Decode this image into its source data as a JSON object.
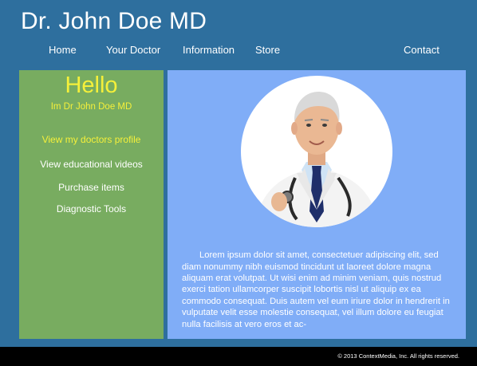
{
  "site": {
    "title": "Dr. John Doe MD"
  },
  "nav": {
    "items": [
      "Home",
      "Your Doctor",
      "Information",
      "Store",
      "Contact"
    ]
  },
  "sidebar": {
    "greeting": "Hello",
    "subtitle": "Im Dr John Doe MD",
    "links": [
      "View my doctors profile",
      "View educational videos",
      "Purchase items",
      "Diagnostic Tools"
    ]
  },
  "main": {
    "text": "Lorem ipsum dolor sit amet, consectetuer adipiscing elit, sed diam nonummy nibh euismod tincidunt ut laoreet dolore magna aliquam erat volutpat. Ut wisi enim ad minim veniam, quis nostrud exerci tation ullamcorper suscipit lobortis nisl ut aliquip ex ea commodo consequat. Duis autem vel eum iriure dolor in hendrerit in vulputate velit esse molestie consequat, vel illum dolore eu feugiat nulla facilisis at vero eros et ac-"
  },
  "footer": {
    "copyright": "© 2013 ContextMedia, Inc. All rights reserved."
  },
  "colors": {
    "page_bg": "#2e6f9e",
    "sidebar_bg": "#78ac60",
    "main_bg": "#80adf7",
    "highlight": "#f5f03a",
    "footer_bg": "#000000"
  }
}
